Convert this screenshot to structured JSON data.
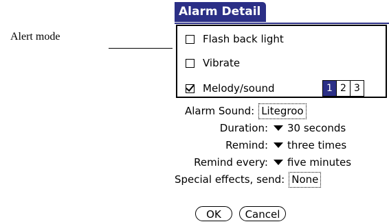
{
  "annotation": {
    "label": "Alert mode"
  },
  "window": {
    "title": "Alarm Detail"
  },
  "alert_modes": [
    {
      "label": "Flash back light",
      "checked": false
    },
    {
      "label": "Vibrate",
      "checked": false
    },
    {
      "label": "Melody/sound",
      "checked": true
    }
  ],
  "repeat_selector": {
    "options": [
      "1",
      "2",
      "3"
    ],
    "selected": "1"
  },
  "fields": {
    "alarm_sound": {
      "label": "Alarm Sound:",
      "value": "Litegroo"
    },
    "duration": {
      "label": "Duration:",
      "value": "30 seconds"
    },
    "remind": {
      "label": "Remind:",
      "value": "three times"
    },
    "remind_every": {
      "label": "Remind every:",
      "value": "five minutes"
    },
    "special_effects": {
      "label": "Special effects, send:",
      "value": "None"
    }
  },
  "buttons": {
    "ok": "OK",
    "cancel": "Cancel"
  },
  "colors": {
    "title_bar": "#2b2f86",
    "selected_segment": "#2b2f86"
  }
}
